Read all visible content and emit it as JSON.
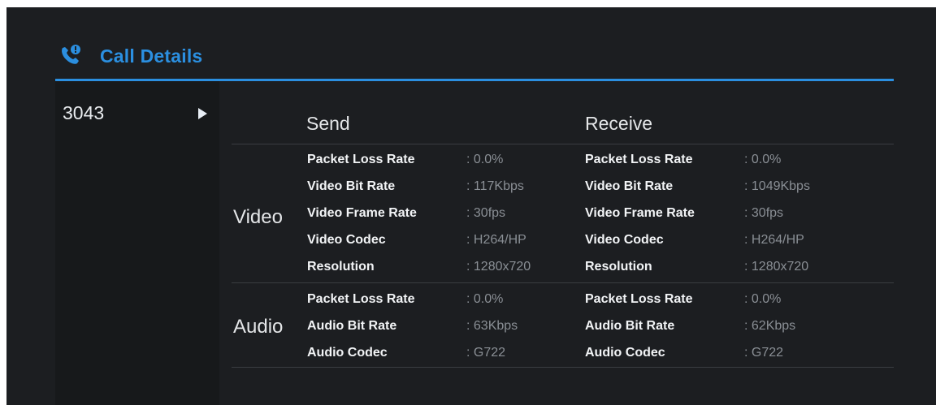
{
  "header": {
    "title": "Call Details",
    "icon": "phone-call-icon",
    "accent_color": "#2b8fe0"
  },
  "sidebar": {
    "items": [
      {
        "label": "3043",
        "selected": true,
        "icon": "play-arrow-icon"
      }
    ]
  },
  "columns": {
    "send": "Send",
    "receive": "Receive"
  },
  "video": {
    "label": "Video",
    "rows": [
      {
        "name": "Packet Loss Rate",
        "send": ": 0.0%",
        "receive": ": 0.0%"
      },
      {
        "name": "Video Bit Rate",
        "send": ": 117Kbps",
        "receive": ": 1049Kbps"
      },
      {
        "name": "Video Frame Rate",
        "send": ": 30fps",
        "receive": ": 30fps"
      },
      {
        "name": "Video Codec",
        "send": ": H264/HP",
        "receive": ": H264/HP"
      },
      {
        "name": "Resolution",
        "send": ": 1280x720",
        "receive": ": 1280x720"
      }
    ]
  },
  "audio": {
    "label": "Audio",
    "rows": [
      {
        "name": "Packet Loss Rate",
        "send": ": 0.0%",
        "receive": ": 0.0%"
      },
      {
        "name": "Audio Bit Rate",
        "send": ": 63Kbps",
        "receive": ": 62Kbps"
      },
      {
        "name": "Audio Codec",
        "send": ": G722",
        "receive": ": G722"
      }
    ]
  }
}
